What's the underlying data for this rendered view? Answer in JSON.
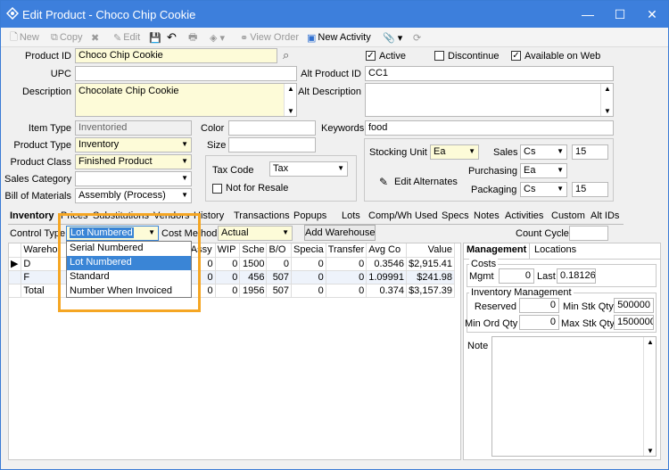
{
  "window": {
    "title": "Edit Product - Choco Chip Cookie",
    "controls": {
      "minimize": "—",
      "maximize": "☐",
      "close": "✕"
    }
  },
  "toolbar": {
    "new": "New",
    "copy": "Copy",
    "edit": "Edit",
    "view_order": "View Order",
    "new_activity": "New Activity"
  },
  "form": {
    "product_id_label": "Product ID",
    "product_id": "Choco Chip Cookie",
    "upc_label": "UPC",
    "upc": "",
    "description_label": "Description",
    "description": "Chocolate Chip Cookie",
    "item_type_label": "Item Type",
    "item_type": "Inventoried",
    "product_type_label": "Product Type",
    "product_type": "Inventory",
    "product_class_label": "Product Class",
    "product_class": "Finished Product",
    "sales_category_label": "Sales Category",
    "sales_category": "",
    "bom_label": "Bill of Materials",
    "bom": "Assembly (Process)",
    "active_label": "Active",
    "discontinue_label": "Discontinue",
    "available_web_label": "Available on Web",
    "alt_product_id_label": "Alt Product ID",
    "alt_product_id": "CC1",
    "alt_description_label": "Alt Description",
    "alt_description": "",
    "color_label": "Color",
    "color": "",
    "size_label": "Size",
    "size": "",
    "keywords_label": "Keywords",
    "keywords": "food",
    "tax_code_label": "Tax Code",
    "tax_code": "Tax",
    "not_for_resale_label": "Not for Resale",
    "stocking_unit_label": "Stocking Unit",
    "stocking_unit": "Ea",
    "sales_label": "Sales",
    "sales_unit": "Cs",
    "sales_qty": "15",
    "purchasing_label": "Purchasing",
    "purchasing_unit": "Ea",
    "packaging_label": "Packaging",
    "packaging_unit": "Cs",
    "packaging_qty": "15",
    "edit_alternates_label": "Edit Alternates"
  },
  "tabs": [
    "Inventory",
    "Prices",
    "Substitutions",
    "Vendors",
    "History",
    "Transactions",
    "Popups",
    "Lots",
    "Comp/Wh Used",
    "Specs",
    "Notes",
    "Activities",
    "Custom",
    "Alt IDs"
  ],
  "inventory": {
    "control_type_label": "Control Type",
    "control_type": "Lot Numbered",
    "cost_method_label": "Cost Method",
    "cost_method": "Actual",
    "add_warehouse_label": "Add Warehouse",
    "count_cycle_label": "Count Cycle",
    "count_cycle": "",
    "dropdown_options": [
      "Serial Numbered",
      "Lot Numbered",
      "Standard",
      "Number When Invoiced"
    ],
    "columns": [
      "Wareho",
      "Assy",
      "WIP",
      "Sche",
      "B/O",
      "Specia",
      "Transfer",
      "Avg Co",
      "Value"
    ],
    "rows": [
      {
        "marker": "▶",
        "wh": "D",
        "assy": "0",
        "wip": "0",
        "sched": "1500",
        "bo": "0",
        "special": "0",
        "transfer": "0",
        "avg": "0.3546",
        "value": "$2,915.41"
      },
      {
        "marker": "",
        "wh": "F",
        "assy": "0",
        "wip": "0",
        "sched": "456",
        "bo": "507",
        "special": "0",
        "transfer": "0",
        "avg": "1.09991",
        "value": "$241.98"
      },
      {
        "marker": "",
        "wh": "Total",
        "assy": "0",
        "wip": "0",
        "sched": "1956",
        "bo": "507",
        "special": "0",
        "transfer": "0",
        "avg": "0.374",
        "value": "$3,157.39"
      }
    ]
  },
  "management": {
    "tab_management": "Management",
    "tab_locations": "Locations",
    "costs_label": "Costs",
    "mgmt_label": "Mgmt",
    "mgmt": "0",
    "last_label": "Last",
    "last": "0.18126",
    "inv_mgmt_label": "Inventory Management",
    "reserved_label": "Reserved",
    "reserved": "0",
    "min_stk_label": "Min Stk Qty",
    "min_stk": "500000",
    "min_ord_label": "Min Ord Qty",
    "min_ord": "0",
    "max_stk_label": "Max Stk Qty",
    "max_stk": "1500000",
    "note_label": "Note"
  }
}
